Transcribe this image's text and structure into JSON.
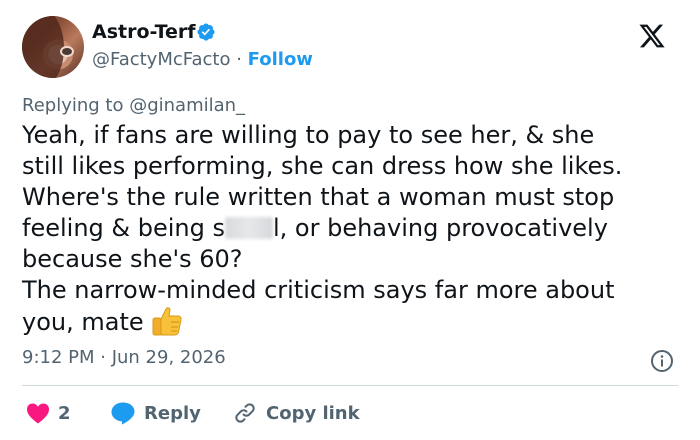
{
  "author": {
    "display_name": "Astro-Terf",
    "handle": "@FactyMcFacto",
    "separator": "·",
    "follow_label": "Follow"
  },
  "reply_context": {
    "prefix": "Replying to ",
    "mention": "@ginamilan_"
  },
  "tweet": {
    "line1": "Yeah, if fans are willing to pay to see her, & she",
    "line2": "still likes performing, she can dress how she likes.",
    "line3": "Where's the rule written that a woman must stop",
    "line4_before": "feeling & being s",
    "line4_after": "l, or behaving provocatively",
    "line5": "because she's 60?",
    "line6": "The narrow-minded criticism says far more about",
    "line7": "you, mate"
  },
  "timestamp": "9:12 PM · Jun 29, 2026",
  "actions": {
    "like_count": "2",
    "reply_label": "Reply",
    "copy_link_label": "Copy link"
  },
  "colors": {
    "link_blue": "#1d9bf0",
    "like_red": "#f91880",
    "muted": "#536471",
    "text": "#0f1419"
  },
  "icons": [
    "verified-badge-icon",
    "x-logo-icon",
    "info-icon",
    "heart-icon",
    "reply-bubble-icon",
    "link-icon",
    "thumbs-up-emoji"
  ]
}
